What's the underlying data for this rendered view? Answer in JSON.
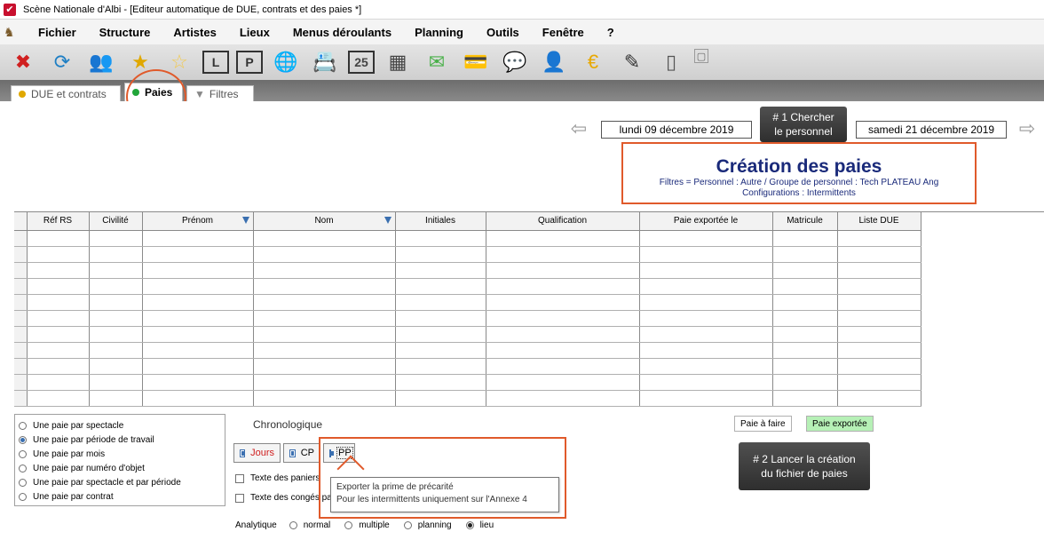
{
  "window": {
    "title": "Scène Nationale d'Albi - [Editeur automatique de DUE, contrats et des paies *]"
  },
  "menu": [
    "Fichier",
    "Structure",
    "Artistes",
    "Lieux",
    "Menus déroulants",
    "Planning",
    "Outils",
    "Fenêtre",
    "?"
  ],
  "toolbar": {
    "icons": [
      "close-icon",
      "refresh-icon",
      "people-icon",
      "star-icon",
      "star-outline-icon",
      "list-l-icon",
      "list-p-icon",
      "globe-icon",
      "contact-card-icon",
      "calendar-25-icon",
      "calendar-grid-icon",
      "envelope-icon",
      "credit-card-icon",
      "chat-users-icon",
      "money-user-icon",
      "euro-icon",
      "pen-icon",
      "document-icon",
      "settings-small-icon"
    ],
    "glyphs": [
      "✖",
      "⟳",
      "👥",
      "★",
      "☆",
      "L",
      "P",
      "🌐",
      "📇",
      "25",
      "▦",
      "✉",
      "💳",
      "💬",
      "👤",
      "€",
      "✎",
      "▯",
      "▢"
    ]
  },
  "tabs": [
    {
      "label": "DUE et contrats",
      "color": "#e0a800"
    },
    {
      "label": "Paies",
      "color": "#22a63a"
    },
    {
      "label": "Filtres",
      "color": "#8a8a8a"
    }
  ],
  "header": {
    "date_start": "lundi 09 décembre 2019",
    "date_end": "samedi 21 décembre 2019",
    "search_button": [
      "# 1 Chercher",
      "le personnel"
    ],
    "creation_title": "Création des paies",
    "filter_line": "Filtres = Personnel : Autre / Groupe de personnel : Tech PLATEAU Ang",
    "config_line": "Configurations : Intermittents"
  },
  "grid": {
    "columns": [
      "Réf RS",
      "Civilité",
      "Prénom",
      "Nom",
      "Initiales",
      "Qualification",
      "Paie exportée le",
      "Matricule",
      "Liste DUE"
    ],
    "row_count": 11
  },
  "options": {
    "radio_items": [
      "Une paie par spectacle",
      "Une paie par période de travail",
      "Une paie par mois",
      "Une paie par numéro d'objet",
      "Une paie par spectacle et par période",
      "Une paie par contrat"
    ],
    "selected_index": 1,
    "chrono_label": "Chronologique",
    "toggle_jours": "Jours",
    "toggle_cp": "CP",
    "toggle_pp": "PP",
    "check_paniers": "Texte des paniers",
    "check_conges": "Texte des congés pa",
    "tooltip_line1": "Exporter la prime de précarité",
    "tooltip_line2": "Pour les intermittents uniquement sur l'Annexe 4",
    "analytique_label": "Analytique",
    "analytique_options": [
      "normal",
      "multiple",
      "planning",
      "lieu"
    ],
    "analytique_selected": 3
  },
  "status": {
    "paie_a_faire": "Paie à faire",
    "paie_exportee": "Paie exportée",
    "paie_exportee_color": "#b6f0b6",
    "launch_button": [
      "# 2 Lancer la création",
      "du fichier de paies"
    ]
  }
}
